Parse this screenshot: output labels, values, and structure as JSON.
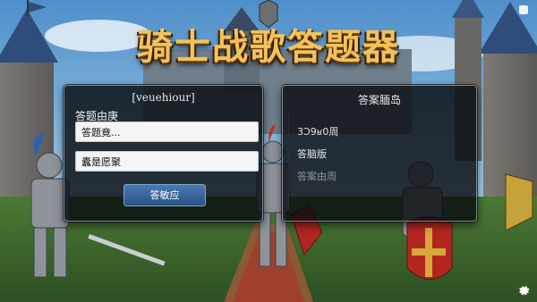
{
  "app": {
    "title": "骑士战歌答题器"
  },
  "left_panel": {
    "header": "[veuehiour]",
    "field_label": "答题由庚",
    "input1_value": "答题竟...",
    "input2_value": "蠹是愿聚",
    "submit_label": "答敏应"
  },
  "right_panel": {
    "header": "答案腼岛",
    "items": [
      "3Ɔ9ʁ0周",
      "答脑版",
      "答案由周"
    ]
  },
  "colors": {
    "title_gold": "#f1c35a",
    "button_blue": "#2a5286",
    "panel_bg": "#080c10"
  },
  "icons": [
    "gear-icon",
    "window-icon"
  ]
}
